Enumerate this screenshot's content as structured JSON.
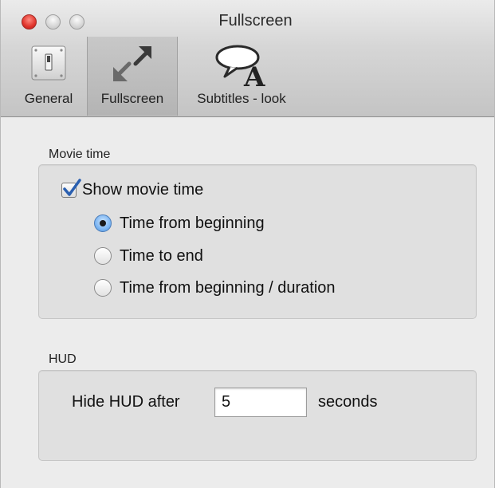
{
  "window": {
    "title": "Fullscreen"
  },
  "toolbar": {
    "items": [
      {
        "label": "General",
        "icon": "light-switch-icon"
      },
      {
        "label": "Fullscreen",
        "icon": "fullscreen-arrows-icon",
        "selected": true
      },
      {
        "label": "Subtitles - look",
        "icon": "speech-bubble-letter-icon"
      }
    ]
  },
  "movie_time": {
    "section_label": "Movie time",
    "show_checkbox": {
      "label": "Show movie time",
      "checked": true
    },
    "options": [
      {
        "label": "Time from beginning",
        "selected": true
      },
      {
        "label": "Time to end",
        "selected": false
      },
      {
        "label": "Time from beginning / duration",
        "selected": false
      }
    ]
  },
  "hud": {
    "section_label": "HUD",
    "hide_label": "Hide HUD after",
    "hide_value": "5",
    "unit_label": "seconds"
  },
  "colors": {
    "close_button": "#e0342b",
    "selected_radio": "#7db6f2",
    "checkmark": "#2a5fb0"
  }
}
